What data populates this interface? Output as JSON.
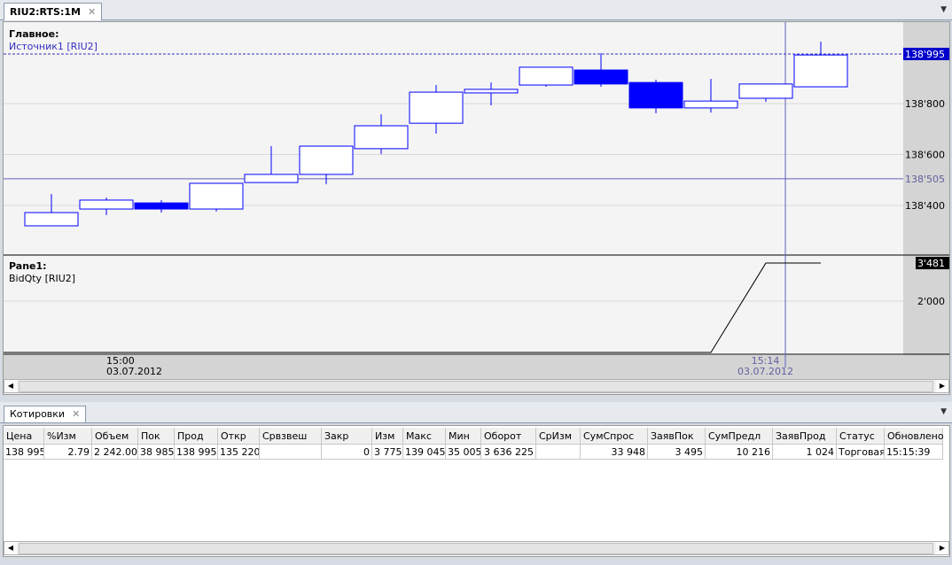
{
  "window": {
    "tab_title": "RIU2:RTS:1M",
    "close": "✕",
    "menu": "▼"
  },
  "chart": {
    "main_pane_title": "Главное:",
    "main_series": "Источник1 [RIU2]",
    "lower_pane_title": "Pane1:",
    "lower_series": "BidQty [RIU2]",
    "price_ticks": [
      "138'400",
      "138'600",
      "138'800"
    ],
    "price_tick_values": [
      138400,
      138600,
      138800
    ],
    "last_price_label": "138'995",
    "last_price": 138995,
    "cursor_price_label": "138'505",
    "cursor_price": 138505,
    "qty_ticks": [
      "2'000"
    ],
    "qty_tick_values": [
      2000
    ],
    "last_qty_label": "3'481",
    "last_qty": 3481,
    "time_label_1": "15:00",
    "date_label_1": "03.07.2012",
    "cursor_time": "15:14",
    "cursor_date": "03.07.2012",
    "colors": {
      "candle": "#0000ff",
      "crosshair": "#6060c0"
    },
    "candles": [
      [
        138320,
        138445,
        138320,
        138372
      ],
      [
        138386,
        138431,
        138362,
        138421
      ],
      [
        138410,
        138421,
        138372,
        138386
      ],
      [
        138386,
        138487,
        138376,
        138487
      ],
      [
        138490,
        138633,
        138490,
        138522
      ],
      [
        138522,
        138633,
        138483,
        138633
      ],
      [
        138623,
        138758,
        138602,
        138713
      ],
      [
        138723,
        138873,
        138682,
        138845
      ],
      [
        138842,
        138883,
        138793,
        138856
      ],
      [
        138873,
        138943,
        138866,
        138943
      ],
      [
        138932,
        138998,
        138866,
        138877
      ],
      [
        138883,
        138894,
        138762,
        138783
      ],
      [
        138783,
        138897,
        138765,
        138810
      ],
      [
        138821,
        138877,
        138807,
        138877
      ],
      [
        138866,
        139043,
        138866,
        138991
      ]
    ],
    "bidqty": [
      0,
      0,
      0,
      0,
      0,
      0,
      0,
      0,
      0,
      0,
      0,
      0,
      0,
      3481,
      3481
    ]
  },
  "quotes": {
    "tab_title": "Котировки",
    "close": "✕",
    "columns": [
      "Цена",
      "%Изм",
      "Объем",
      "Пок",
      "Прод",
      "Откр",
      "Срвзвеш",
      "Закр",
      "Изм",
      "Макс",
      "Мин",
      "Оборот",
      "СрИзм",
      "СумСпрос",
      "ЗаявПок",
      "СумПредл",
      "ЗаявПрод",
      "Статус",
      "Обновлено"
    ],
    "row": [
      "138 995",
      "2.79",
      "2 242.00",
      "38 985",
      "138 995",
      "135 220",
      "",
      "0",
      "3 775",
      "139 045",
      "35 005",
      "3 636 225",
      "",
      "33 948",
      "3 495",
      "10 216",
      "1 024",
      "Торговая",
      "15:15:39"
    ]
  }
}
